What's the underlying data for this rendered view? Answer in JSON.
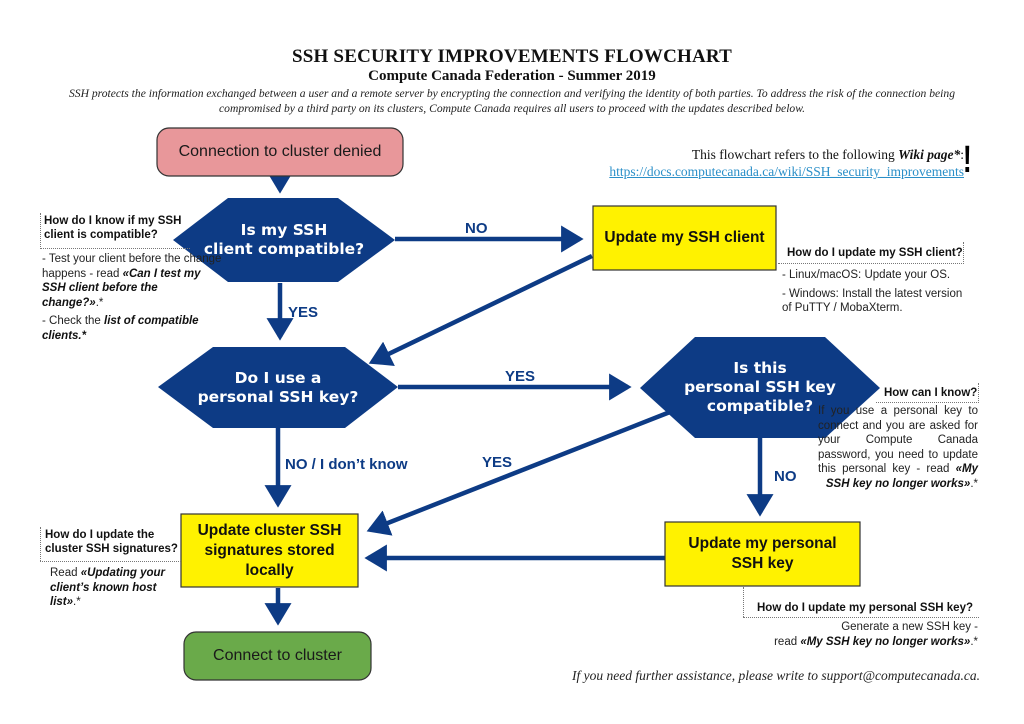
{
  "header": {
    "title": "SSH SECURITY IMPROVEMENTS FLOWCHART",
    "subtitle": "Compute Canada Federation - Summer 2019",
    "intro": "SSH protects the information exchanged between a user and a remote server by encrypting the connection and verifying the identity of both parties. To address the risk of the connection being compromised by a third party on its clusters, Compute Canada requires all users to proceed with the updates described below."
  },
  "wiki": {
    "ref_prefix": "This flowchart refers to the following ",
    "ref_emph": "Wiki page*",
    "ref_suffix": ":",
    "url": "https://docs.computecanada.ca/wiki/SSH_security_improvements",
    "icon": "exclamation-icon",
    "icon_glyph": "!"
  },
  "colors": {
    "decision": "#0d3b85",
    "arrow": "#0d3b85",
    "action": "#fff200",
    "start": "#e8979a",
    "end": "#6aaa4a",
    "link": "#2a8fc8"
  },
  "nodes": {
    "start": "Connection to cluster denied",
    "q_client": [
      "Is my SSH",
      "client compatible?"
    ],
    "update_client": "Update my SSH client",
    "q_personal_key": [
      "Do I use a",
      "personal SSH key?"
    ],
    "q_key_compatible": [
      "Is this",
      "personal SSH key",
      "compatible?"
    ],
    "update_signatures": [
      "Update cluster SSH",
      "signatures stored",
      "locally"
    ],
    "update_personal_key": [
      "Update my personal",
      "SSH key"
    ],
    "end": "Connect to cluster"
  },
  "edges": {
    "client_no": "NO",
    "client_yes": "YES",
    "personal_yes": "YES",
    "personal_no": "NO / I don’t know",
    "compatible_yes": "YES",
    "compatible_no": "NO"
  },
  "notes": {
    "client_compat": {
      "heading": "How do I know if my SSH client is compatible?",
      "items": [
        {
          "text": "- Test your client before the change happens - read ",
          "emph": "«Can I test my SSH client before the change?»",
          "tail": ".*"
        },
        {
          "text": "- Check the ",
          "emph": "list of compatible clients.*",
          "tail": ""
        }
      ]
    },
    "update_client": {
      "heading": "How do I update my SSH client?",
      "items": [
        "- Linux/macOS: Update your OS.",
        "- Windows: Install the latest version of PuTTY / MobaXterm."
      ]
    },
    "how_know": {
      "heading": "How can I know?",
      "text": "If you use a personal key to connect and you are asked for your Compute Canada password, you need to update this personal key - read ",
      "emph": "«My SSH key no longer works»",
      "tail": ".*"
    },
    "update_signatures": {
      "heading": "How do I update the cluster SSH signatures?",
      "text": "Read ",
      "emph": "«Updating your client’s known host list»",
      "tail": ".*"
    },
    "update_personal_key": {
      "heading": "How do I update my personal SSH key?",
      "line1": "Generate a new SSH key -",
      "text": "read ",
      "emph": "«My SSH key no longer works»",
      "tail": ".*"
    }
  },
  "footer": "If you need further assistance, please write to support@computecanada.ca."
}
